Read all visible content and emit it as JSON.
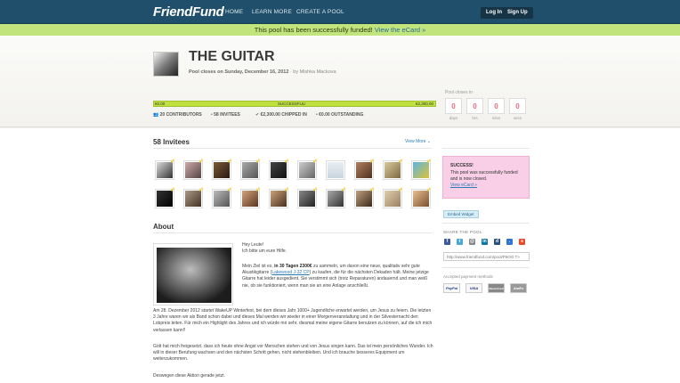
{
  "nav": {
    "logo": "FriendFund",
    "links": [
      "HOME",
      "LEARN MORE",
      "CREATE A POOL"
    ],
    "login": "Log In",
    "signup": "Sign Up"
  },
  "banner": {
    "text": "This pool has been successfully funded!",
    "link": "View the eCard »"
  },
  "pool": {
    "title": "THE GUITAR",
    "closes": "Pool closes on Sunday, December 16, 2012",
    "by": "· by Mishka Mackova",
    "progress_fraction": 1.0,
    "progress_left": "€0.00",
    "progress_center": "SUCCESSFUL!",
    "progress_right": "€2,300.00",
    "stats": {
      "contributors": "20 CONTRIBUTORS",
      "invitees": "58 INVITEES",
      "chipped": "€2,300.00 CHIPPED IN",
      "outstanding": "€0.00 OUTSTANDING"
    },
    "countdown": {
      "label": "Pool closes in",
      "values": [
        "0",
        "0",
        "0",
        "0"
      ],
      "units": [
        "days",
        "hrs",
        "mins",
        "secs"
      ]
    }
  },
  "invitees": {
    "heading": "58 Invitees",
    "view_more": "View More"
  },
  "about": {
    "heading": "About",
    "greeting1": "Hey Leute!",
    "greeting2": "Ich bitte um eure Hilfe.",
    "p1_a": "Mein Ziel ist es,",
    "p1_bold": "in 30 Tagen 2300€",
    "p1_b": "zu sammeln, um davon eine neue, qualitativ sehr gute Akustikgitarre (",
    "p1_link": "Lakewood J-32 CP",
    "p1_c": ") zu kaufen, die für die nächsten Dekaden hält. Meine jetzige Gitarre hat leider ausgedient. Sie verstimmt sich (trotz Reparaturen) andauernd und man weiß nie, ob sie funktioniert, wenn man sie an eine Anlage anschließt.",
    "p2": "Am 28. Dezember 2012 startet WakeUP Winterfest, bei dem dieses Jahr 1000+ Jugendliche erwartet werden, um Jesus zu feiern. Die letzten 3 Jahre waren wir als Band schon dabei und dieses Mal werden wir wieder in einer Morgenveranstaltung und in der Silvesternacht den Lobpreis leiten. Für mich ein Highlight des Jahres und ich würde mir sehr, diesmal meine eigene Gitarre benutzen zu können, auf die ich mich verlassen kann!!",
    "p3": "Gott hat mich freigesetzt, dass ich heute ohne Angst vor Menschen stehen und von Jesus singen kann. Das ist mein persönliches Wunder. Ich will in dieser Berufung wachsen und den nächsten Schritt gehen, nicht stehenbleiben. Und ich brauche besseres Equipment um weiterzukommen.",
    "p4": "Deswegen diese Aktion gerade jetzt."
  },
  "sidebar": {
    "success_title": "SUCCESS!",
    "success_msg": "This pool was successfully funded and is now closed.",
    "success_link": "View eCard »",
    "embed": "Embed Widget",
    "share_heading": "SHARE THE POOL",
    "share_url": "http://www.friendfund.com/pool/P5OO.T>",
    "accepted": "Accepted payment methods",
    "payments": [
      "PayPal",
      "VISA",
      "MasterCard",
      "AmEx"
    ]
  },
  "icons": {
    "share": [
      "facebook-icon",
      "twitter-icon",
      "email-icon",
      "linkedin-icon",
      "digg-icon",
      "delicious-icon",
      "stumbleupon-icon",
      "google-plus-icon"
    ],
    "share_colors": [
      "#3b5998",
      "#4aa8d8",
      "#888888",
      "#0e76a8",
      "#2b4f81",
      "#3274d1",
      "#eb4924",
      "#e8772a"
    ]
  },
  "colors": {
    "nav_bg": "#1f4f6a",
    "banner_bg": "#c2e47d",
    "progress_fill": "#bfe03f",
    "countdown_digit": "#ec6d7e",
    "success_bg": "#f8cfe6",
    "link": "#2b7bb3"
  }
}
